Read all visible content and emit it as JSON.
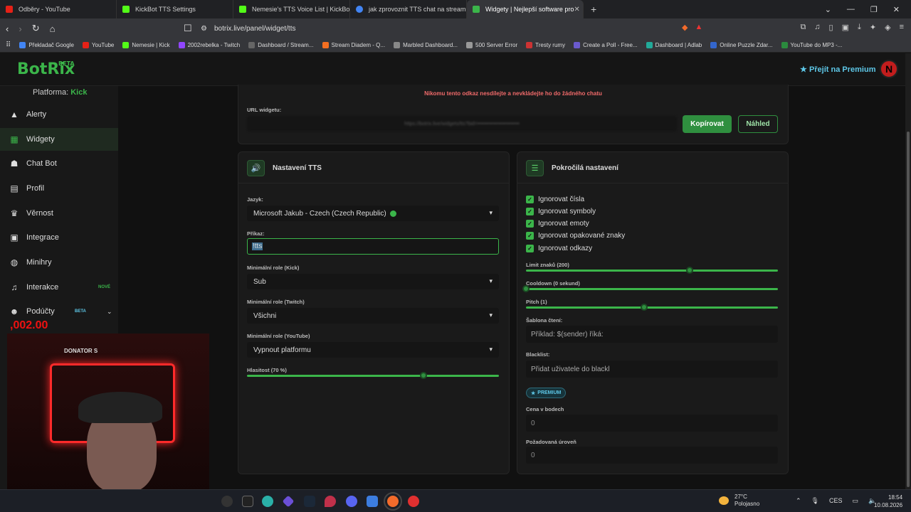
{
  "browser": {
    "tabs": [
      {
        "title": "Odběry - YouTube",
        "color": "#e62117"
      },
      {
        "title": "KickBot TTS Settings",
        "color": "#53fc18"
      },
      {
        "title": "Nemesie's TTS Voice List | KickBot",
        "color": "#53fc18"
      },
      {
        "title": "jak zprovoznit TTS chat na streamu -",
        "color": "#4285f4"
      },
      {
        "title": "Widgety | Nejlepší software pro",
        "color": "#3bb54a"
      }
    ],
    "url": "botrix.live/panel/widget/tts",
    "bookmarks": [
      {
        "label": "Překladač Google",
        "color": "#4285f4"
      },
      {
        "label": "YouTube",
        "color": "#e62117"
      },
      {
        "label": "Nemesie | Kick",
        "color": "#53fc18"
      },
      {
        "label": "2002rebelka - Twitch",
        "color": "#9146ff"
      },
      {
        "label": "Dashboard / Stream...",
        "color": "#666"
      },
      {
        "label": "Stream Diadem - Q...",
        "color": "#f36f21"
      },
      {
        "label": "Marbled Dashboard...",
        "color": "#888"
      },
      {
        "label": "500 Server Error",
        "color": "#999"
      },
      {
        "label": "Tresty rumy",
        "color": "#c33"
      },
      {
        "label": "Create a Poll - Free...",
        "color": "#6a5acd"
      },
      {
        "label": "Dashboard | Adlab",
        "color": "#2a9"
      },
      {
        "label": "Online Puzzle Zdar...",
        "color": "#3366cc"
      },
      {
        "label": "YouTube do MP3 -...",
        "color": "#2b8a3e"
      }
    ]
  },
  "app": {
    "logo": "BotRix",
    "logo_beta": "BETA",
    "premium_link": "Přejít na Premium",
    "avatar_letter": "N",
    "platform_label": "Platforma:",
    "platform_value": "Kick",
    "sidebar": [
      {
        "label": "Alerty",
        "icon": "warning-icon"
      },
      {
        "label": "Widgety",
        "icon": "grid-icon",
        "active": true
      },
      {
        "label": "Chat Bot",
        "icon": "robot-icon"
      },
      {
        "label": "Profil",
        "icon": "id-card-icon"
      },
      {
        "label": "Věrnost",
        "icon": "trophy-icon"
      },
      {
        "label": "Integrace",
        "icon": "plug-icon"
      },
      {
        "label": "Minihry",
        "icon": "gamepad-icon"
      },
      {
        "label": "Interakce",
        "icon": "music-icon",
        "badge": "NOVÉ"
      },
      {
        "label": "Podúčty",
        "icon": "users-icon",
        "badge": "BETA"
      }
    ]
  },
  "widget": {
    "warning": "Nikomu tento odkaz nesdílejte a nevkládejte ho do žádného chatu",
    "url_label": "URL widgetu:",
    "copy_button": "Kopírovat",
    "preview_button": "Náhled"
  },
  "tts": {
    "title": "Nastavení TTS",
    "language_label": "Jazyk:",
    "language_value": "Microsoft Jakub - Czech (Czech Republic)",
    "command_label": "Příkaz:",
    "command_value": "!tts",
    "role_kick_label": "Minimální role (Kick)",
    "role_kick_value": "Sub",
    "role_twitch_label": "Minimální role (Twitch)",
    "role_twitch_value": "Všichni",
    "role_youtube_label": "Minimální role (YouTube)",
    "role_youtube_value": "Vypnout platformu",
    "volume_label": "Hlasitost (70 %)",
    "volume_value": 0.7
  },
  "advanced": {
    "title": "Pokročilá nastavení",
    "checkboxes": [
      "Ignorovat čísla",
      "Ignorovat symboly",
      "Ignorovat emoty",
      "Ignorovat opakované znaky",
      "Ignorovat odkazy"
    ],
    "char_limit_label": "Limit znaků (200)",
    "char_limit_value": 0.65,
    "cooldown_label": "Cooldown (0 sekund)",
    "cooldown_value": 0.0,
    "pitch_label": "Pitch (1)",
    "pitch_value": 0.47,
    "template_label": "Šablona čtení:",
    "template_placeholder": "Příklad: $(sender) říká:",
    "blacklist_label": "Blacklist:",
    "blacklist_placeholder": "Přidat uživatele do blackl",
    "premium_badge": "PREMIUM",
    "points_label": "Cena v bodech",
    "points_value": "0",
    "level_label": "Požadovaná úroveň",
    "level_value": "0"
  },
  "overlay": {
    "donation_text": ",002.00",
    "cam_sign": "DONATOR S"
  },
  "taskbar": {
    "temperature": "27°C",
    "weather": "Polojasno",
    "language": "CES",
    "time": "18:54",
    "date": "10.08.2026"
  }
}
